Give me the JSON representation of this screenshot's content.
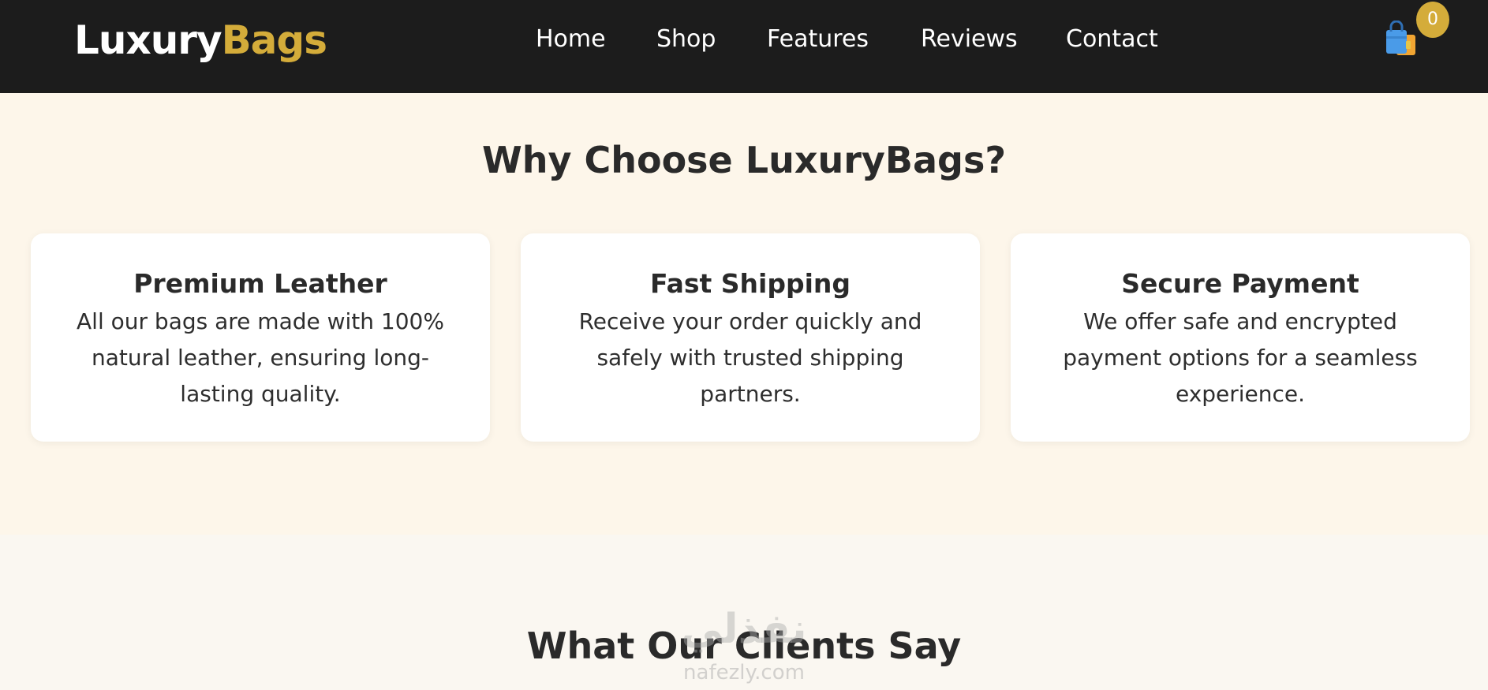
{
  "brand": {
    "part1": "Luxury",
    "part2": "Bags",
    "accent_color": "#d4ac3a"
  },
  "nav": {
    "links": [
      {
        "label": "Home"
      },
      {
        "label": "Shop"
      },
      {
        "label": "Features"
      },
      {
        "label": "Reviews"
      },
      {
        "label": "Contact"
      }
    ],
    "cart": {
      "icon": "shopping-bag-icon",
      "count": "0"
    }
  },
  "features": {
    "title": "Why Choose LuxuryBags?",
    "cards": [
      {
        "title": "Premium Leather",
        "text": "All our bags are made with 100% natural leather, ensuring long-lasting quality."
      },
      {
        "title": "Fast Shipping",
        "text": "Receive your order quickly and safely with trusted shipping partners."
      },
      {
        "title": "Secure Payment",
        "text": "We offer safe and encrypted payment options for a seamless experience."
      }
    ]
  },
  "testimonials": {
    "title": "What Our Clients Say"
  },
  "watermark": {
    "arabic": "نفذلي",
    "latin": "nafezly.com"
  }
}
